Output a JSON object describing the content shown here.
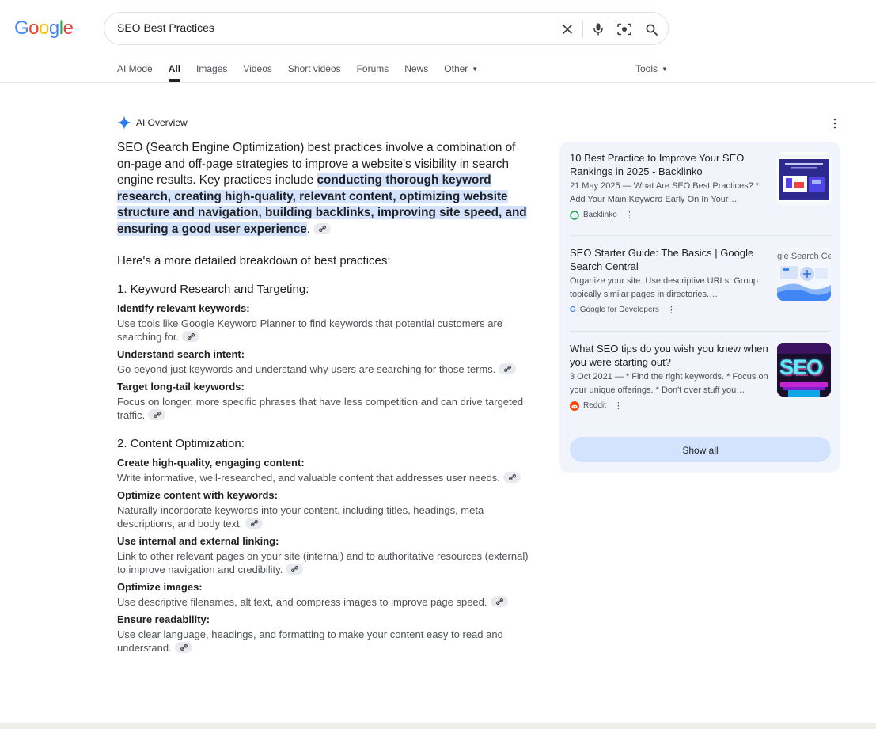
{
  "logo": {
    "letters": [
      {
        "ch": "G",
        "color": "#4285f4"
      },
      {
        "ch": "o",
        "color": "#ea4335"
      },
      {
        "ch": "o",
        "color": "#fbbc05"
      },
      {
        "ch": "g",
        "color": "#4285f4"
      },
      {
        "ch": "l",
        "color": "#34a853"
      },
      {
        "ch": "e",
        "color": "#ea4335"
      }
    ]
  },
  "search": {
    "query": "SEO Best Practices",
    "icons": [
      "close-icon",
      "mic-icon",
      "lens-icon",
      "search-icon"
    ]
  },
  "tabs": [
    {
      "label": "AI Mode",
      "active": false
    },
    {
      "label": "All",
      "active": true
    },
    {
      "label": "Images",
      "active": false
    },
    {
      "label": "Videos",
      "active": false
    },
    {
      "label": "Short videos",
      "active": false
    },
    {
      "label": "Forums",
      "active": false
    },
    {
      "label": "News",
      "active": false
    },
    {
      "label": "Other",
      "active": false
    }
  ],
  "tools_label": "Tools",
  "ai_overview": {
    "label": "AI Overview",
    "intro_plain": "SEO (Search Engine Optimization) best practices involve a combination of on-page and off-page strategies to improve a website's visibility in search engine results. Key practices include ",
    "intro_highlight": "conducting thorough keyword research, creating high-quality, relevant content, optimizing website structure and navigation, building backlinks, improving site speed, and ensuring a good user experience",
    "intro_end": ".",
    "breakdown_intro": "Here's a more detailed breakdown of best practices:",
    "sections": [
      {
        "heading": "1. Keyword Research and Targeting:",
        "items": [
          {
            "title": "Identify relevant keywords:",
            "text": "Use tools like Google Keyword Planner to find keywords that potential customers are searching for."
          },
          {
            "title": "Understand search intent:",
            "text": "Go beyond just keywords and understand why users are searching for those terms."
          },
          {
            "title": "Target long-tail keywords:",
            "text": "Focus on longer, more specific phrases that have less competition and can drive targeted traffic."
          }
        ]
      },
      {
        "heading": "2. Content Optimization:",
        "items": [
          {
            "title": "Create high-quality, engaging content:",
            "text": "Write informative, well-researched, and valuable content that addresses user needs."
          },
          {
            "title": "Optimize content with keywords:",
            "text": "Naturally incorporate keywords into your content, including titles, headings, meta descriptions, and body text."
          },
          {
            "title": "Use internal and external linking:",
            "text": "Link to other relevant pages on your site (internal) and to authoritative resources (external) to improve navigation and credibility."
          },
          {
            "title": "Optimize images:",
            "text": "Use descriptive filenames, alt text, and compress images to improve page speed."
          },
          {
            "title": "Ensure readability:",
            "text": "Use clear language, headings, and formatting to make your content easy to read and understand."
          }
        ]
      }
    ]
  },
  "sources": [
    {
      "title": "10 Best Practice to Improve Your SEO Rankings in 2025 - Backlinko",
      "snippet": "21 May 2025 — What Are SEO Best Practices? * Add Your Main Keyword Early On In Your…",
      "site": "Backlinko",
      "favicon": "backlinko-icon"
    },
    {
      "title": "SEO Starter Guide: The Basics | Google Search Central",
      "snippet": "Organize your site. Use descriptive URLs. Group topically similar pages in directories.…",
      "site": "Google for Developers",
      "favicon": "google-icon",
      "thumb_text": "gle Search Cer"
    },
    {
      "title": "What SEO tips do you wish you knew when you were starting out?",
      "snippet": "3 Oct 2021 — * Find the right keywords. * Focus on your unique offerings. * Don't over stuff you…",
      "site": "Reddit",
      "favicon": "reddit-icon",
      "thumb_text": "SEO"
    }
  ],
  "show_all_label": "Show all",
  "colors": {
    "highlight": "#d3e3fd",
    "card_bg": "#f1f4fb",
    "link_text": "#1f1f1f",
    "secondary_text": "#4d5156"
  }
}
